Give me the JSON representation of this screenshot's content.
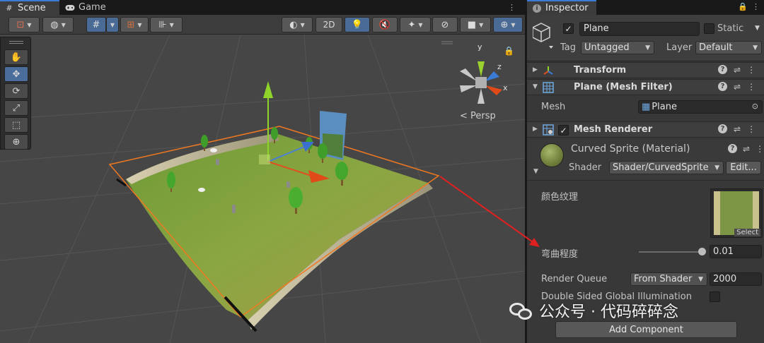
{
  "scene_tabs": [
    {
      "label": "Scene",
      "icon": "hash-icon",
      "active": true
    },
    {
      "label": "Game",
      "icon": "gamepad-icon",
      "active": false
    }
  ],
  "toolbar": {
    "mode_2d": "2D"
  },
  "scene_view": {
    "gizmo_axes": {
      "y": "y",
      "z": "z",
      "x": "x"
    },
    "projection_label": "Persp"
  },
  "inspector": {
    "tab_label": "Inspector",
    "object": {
      "enabled": true,
      "name": "Plane",
      "static_label": "Static",
      "tag_label": "Tag",
      "tag_value": "Untagged",
      "layer_label": "Layer",
      "layer_value": "Default"
    },
    "components": {
      "transform": "Transform",
      "mesh_filter": "Plane (Mesh Filter)",
      "mesh_label": "Mesh",
      "mesh_value": "Plane",
      "mesh_renderer": "Mesh Renderer",
      "mesh_renderer_enabled": true
    },
    "material": {
      "name": "Curved Sprite (Material)",
      "shader_label": "Shader",
      "shader_value": "Shader/CurvedSprite",
      "edit_label": "Edit...",
      "texture_label": "颜色纹理",
      "texture_select": "Select",
      "curve_label": "弯曲程度",
      "curve_value": "0.01",
      "curve_fraction": 1.0,
      "render_queue_label": "Render Queue",
      "render_queue_mode": "From Shader",
      "render_queue_value": "2000",
      "dsgi_label": "Double Sided Global Illumination"
    },
    "add_component": "Add Component"
  },
  "watermark": "公众号 · 代码碎碎念",
  "colors": {
    "accent_blue": "#3a7bd5",
    "selected_tool": "#4b6d9c",
    "outline_orange": "#f07820",
    "annotation_red": "#e02020"
  }
}
